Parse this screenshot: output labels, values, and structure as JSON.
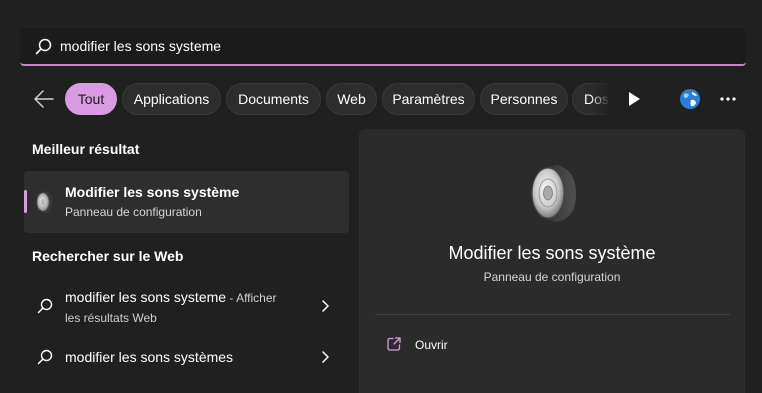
{
  "search": {
    "query": "modifier les sons systeme",
    "icon": "search-icon"
  },
  "filters": {
    "back_icon": "arrow-left-icon",
    "chips": [
      {
        "label": "Tout",
        "active": true
      },
      {
        "label": "Applications",
        "active": false
      },
      {
        "label": "Documents",
        "active": false
      },
      {
        "label": "Web",
        "active": false
      },
      {
        "label": "Paramètres",
        "active": false
      },
      {
        "label": "Personnes",
        "active": false
      },
      {
        "label": "Dos",
        "active": false
      }
    ],
    "scroll_icon": "play-icon",
    "account_icon": "globe-icon",
    "more_icon": "more-icon"
  },
  "results": {
    "best_title": "Meilleur résultat",
    "best": {
      "title": "Modifier les sons système",
      "subtitle": "Panneau de configuration",
      "icon": "speaker-icon"
    },
    "web_title": "Rechercher sur le Web",
    "web": [
      {
        "query": "modifier les sons systeme",
        "suffix": " - Afficher",
        "line2": "les résultats Web"
      },
      {
        "query": "modifier les sons systèmes"
      }
    ]
  },
  "preview": {
    "title": "Modifier les sons système",
    "subtitle": "Panneau de configuration",
    "actions": [
      {
        "label": "Ouvrir",
        "icon": "open-external-icon"
      }
    ]
  },
  "colors": {
    "accent": "#d99be2",
    "background": "#202020",
    "panel": "#2b2b2b"
  }
}
